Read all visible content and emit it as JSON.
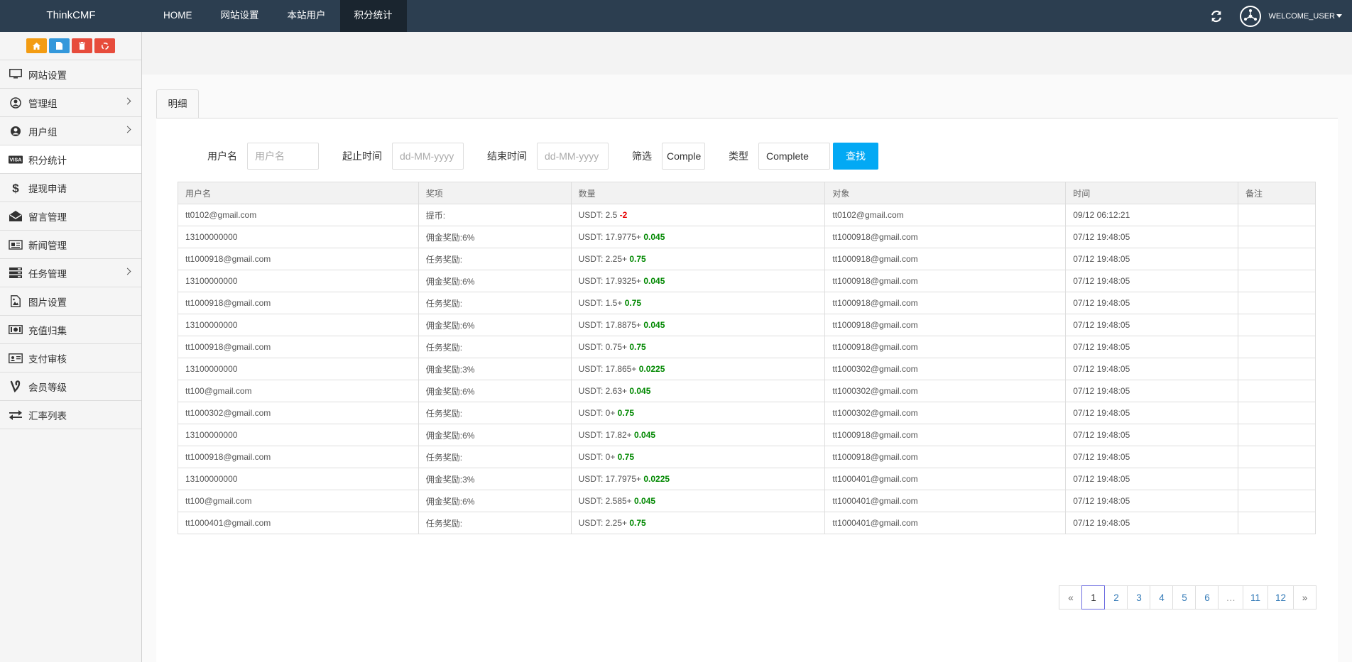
{
  "brand": "ThinkCMF",
  "topnav": [
    "HOME",
    "网站设置",
    "本站用户",
    "积分统计"
  ],
  "user": {
    "name": "WELCOME_USER"
  },
  "sidebar": {
    "items": [
      {
        "label": "网站设置",
        "icon": "monitor-icon"
      },
      {
        "label": "管理组",
        "icon": "user-circle-icon",
        "has_children": true
      },
      {
        "label": "用户组",
        "icon": "user-icon",
        "has_children": true
      },
      {
        "label": "积分统计",
        "icon": "visa-icon",
        "active": true
      },
      {
        "label": "提现申请",
        "icon": "dollar-icon"
      },
      {
        "label": "留言管理",
        "icon": "envelope-open-icon"
      },
      {
        "label": "新闻管理",
        "icon": "newspaper-icon"
      },
      {
        "label": "任务管理",
        "icon": "server-icon",
        "has_children": true
      },
      {
        "label": "图片设置",
        "icon": "image-icon"
      },
      {
        "label": "充值归集",
        "icon": "money-icon"
      },
      {
        "label": "支付审核",
        "icon": "id-card-icon"
      },
      {
        "label": "会员等级",
        "icon": "vine-icon"
      },
      {
        "label": "汇率列表",
        "icon": "exchange-icon"
      }
    ]
  },
  "tab": {
    "label": "明细"
  },
  "filters": {
    "username_label": "用户名",
    "username_placeholder": "用户名",
    "start_label": "起止时间",
    "start_placeholder": "dd-MM-yyyy",
    "end_label": "结束时间",
    "end_placeholder": "dd-MM-yyyy",
    "screen_label": "筛选",
    "screen_value": "Comple",
    "type_label": "类型",
    "type_value": "Complete",
    "search_label": "查找"
  },
  "table": {
    "headers": [
      "用户名",
      "奖项",
      "数量",
      "对象",
      "时间",
      "备注"
    ],
    "rows": [
      {
        "user": "tt0102@gmail.com",
        "award": "提币:",
        "qty_base": "USDT: 2.5",
        "qty_delta": "-2",
        "delta_sign": "neg",
        "target": "tt0102@gmail.com",
        "time": "09/12 06:12:21",
        "note": ""
      },
      {
        "user": "13100000000",
        "award": "佣金奖励:6%",
        "qty_base": "USDT: 17.9775+",
        "qty_delta": "0.045",
        "delta_sign": "pos",
        "target": "tt1000918@gmail.com",
        "time": "07/12 19:48:05",
        "note": ""
      },
      {
        "user": "tt1000918@gmail.com",
        "award": "任务奖励:",
        "qty_base": "USDT: 2.25+",
        "qty_delta": "0.75",
        "delta_sign": "pos",
        "target": "tt1000918@gmail.com",
        "time": "07/12 19:48:05",
        "note": ""
      },
      {
        "user": "13100000000",
        "award": "佣金奖励:6%",
        "qty_base": "USDT: 17.9325+",
        "qty_delta": "0.045",
        "delta_sign": "pos",
        "target": "tt1000918@gmail.com",
        "time": "07/12 19:48:05",
        "note": ""
      },
      {
        "user": "tt1000918@gmail.com",
        "award": "任务奖励:",
        "qty_base": "USDT: 1.5+",
        "qty_delta": "0.75",
        "delta_sign": "pos",
        "target": "tt1000918@gmail.com",
        "time": "07/12 19:48:05",
        "note": ""
      },
      {
        "user": "13100000000",
        "award": "佣金奖励:6%",
        "qty_base": "USDT: 17.8875+",
        "qty_delta": "0.045",
        "delta_sign": "pos",
        "target": "tt1000918@gmail.com",
        "time": "07/12 19:48:05",
        "note": ""
      },
      {
        "user": "tt1000918@gmail.com",
        "award": "任务奖励:",
        "qty_base": "USDT: 0.75+",
        "qty_delta": "0.75",
        "delta_sign": "pos",
        "target": "tt1000918@gmail.com",
        "time": "07/12 19:48:05",
        "note": ""
      },
      {
        "user": "13100000000",
        "award": "佣金奖励:3%",
        "qty_base": "USDT: 17.865+",
        "qty_delta": "0.0225",
        "delta_sign": "pos",
        "target": "tt1000302@gmail.com",
        "time": "07/12 19:48:05",
        "note": ""
      },
      {
        "user": "tt100@gmail.com",
        "award": "佣金奖励:6%",
        "qty_base": "USDT: 2.63+",
        "qty_delta": "0.045",
        "delta_sign": "pos",
        "target": "tt1000302@gmail.com",
        "time": "07/12 19:48:05",
        "note": ""
      },
      {
        "user": "tt1000302@gmail.com",
        "award": "任务奖励:",
        "qty_base": "USDT: 0+",
        "qty_delta": "0.75",
        "delta_sign": "pos",
        "target": "tt1000302@gmail.com",
        "time": "07/12 19:48:05",
        "note": ""
      },
      {
        "user": "13100000000",
        "award": "佣金奖励:6%",
        "qty_base": "USDT: 17.82+",
        "qty_delta": "0.045",
        "delta_sign": "pos",
        "target": "tt1000918@gmail.com",
        "time": "07/12 19:48:05",
        "note": ""
      },
      {
        "user": "tt1000918@gmail.com",
        "award": "任务奖励:",
        "qty_base": "USDT: 0+",
        "qty_delta": "0.75",
        "delta_sign": "pos",
        "target": "tt1000918@gmail.com",
        "time": "07/12 19:48:05",
        "note": ""
      },
      {
        "user": "13100000000",
        "award": "佣金奖励:3%",
        "qty_base": "USDT: 17.7975+",
        "qty_delta": "0.0225",
        "delta_sign": "pos",
        "target": "tt1000401@gmail.com",
        "time": "07/12 19:48:05",
        "note": ""
      },
      {
        "user": "tt100@gmail.com",
        "award": "佣金奖励:6%",
        "qty_base": "USDT: 2.585+",
        "qty_delta": "0.045",
        "delta_sign": "pos",
        "target": "tt1000401@gmail.com",
        "time": "07/12 19:48:05",
        "note": ""
      },
      {
        "user": "tt1000401@gmail.com",
        "award": "任务奖励:",
        "qty_base": "USDT: 2.25+",
        "qty_delta": "0.75",
        "delta_sign": "pos",
        "target": "tt1000401@gmail.com",
        "time": "07/12 19:48:05",
        "note": ""
      }
    ]
  },
  "pagination": {
    "prev": "«",
    "pages": [
      "1",
      "2",
      "3",
      "4",
      "5",
      "6",
      "…",
      "11",
      "12"
    ],
    "current": "1",
    "next": "»"
  },
  "colors": {
    "topbar": "#2c3e50",
    "accent_button": "#03a9f4",
    "negative": "#e60000",
    "positive": "#008800"
  }
}
